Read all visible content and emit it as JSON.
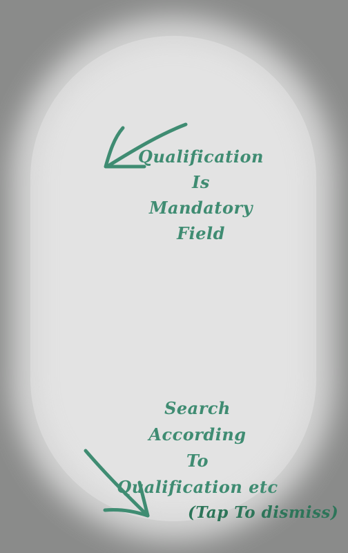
{
  "overlay": {
    "hint_top": {
      "line1": "Qualification",
      "line2": "Is",
      "line3": "Mandatory",
      "line4": "Field"
    },
    "hint_bottom": {
      "line1": "Search According",
      "line2": "To",
      "line3": "Qualification etc"
    },
    "dismiss_label": "(Tap To dismiss)",
    "icons": {
      "top_arrow": "arrow-down-left-icon",
      "bottom_arrow": "arrow-down-right-icon"
    },
    "colors": {
      "text": "#3f8c72",
      "overlay": "#8a8b8a",
      "spotlight": "#e3e3e3"
    }
  }
}
